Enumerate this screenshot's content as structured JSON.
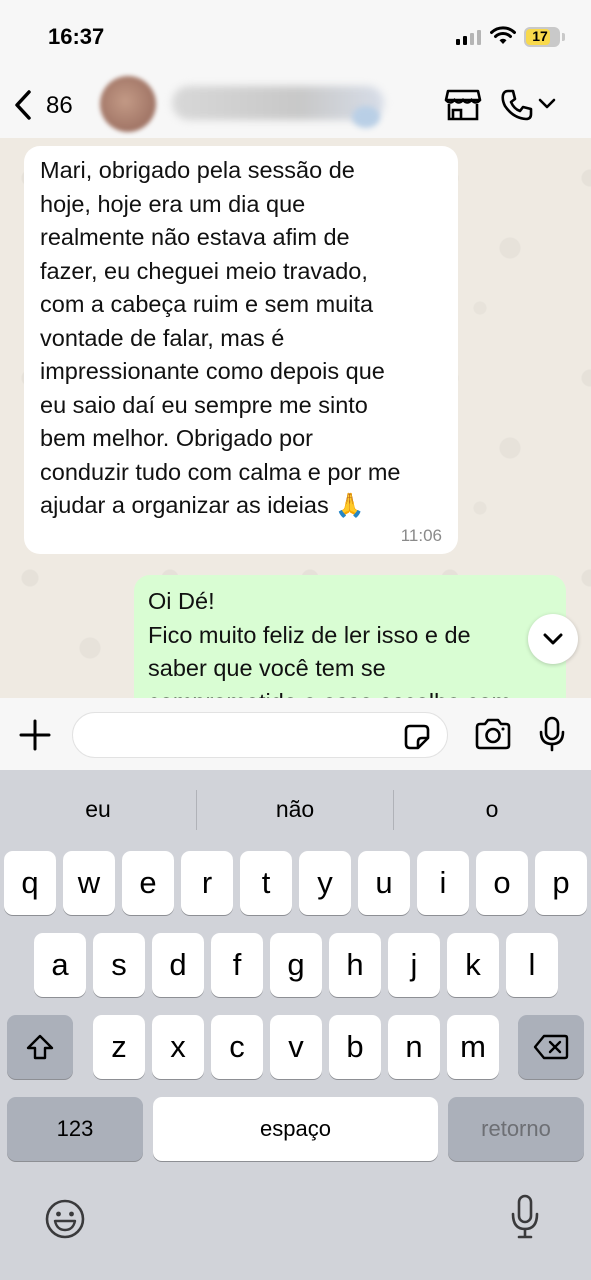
{
  "status_bar": {
    "time": "16:37",
    "battery": "17"
  },
  "header": {
    "unread_count": "86"
  },
  "messages": {
    "incoming": {
      "text": "Mari, obrigado pela sessão de\nhoje, hoje era um dia que\nrealmente não estava afim de\nfazer, eu cheguei meio travado,\ncom a cabeça ruim e sem muita\nvontade de falar, mas é\nimpressionante como depois que\neu saio daí eu sempre me sinto\nbem melhor. Obrigado por\nconduzir tudo com calma e por me\najudar a organizar as ideias 🙏",
      "time": "11:06"
    },
    "outgoing": {
      "text": "Oi Dé!\nFico muito feliz de ler isso e de\nsaber que você tem se\ncomprometido a essa escolha com"
    }
  },
  "keyboard": {
    "suggestions": [
      "eu",
      "não",
      "o"
    ],
    "row1": [
      "q",
      "w",
      "e",
      "r",
      "t",
      "y",
      "u",
      "i",
      "o",
      "p"
    ],
    "row2": [
      "a",
      "s",
      "d",
      "f",
      "g",
      "h",
      "j",
      "k",
      "l"
    ],
    "row3": [
      "z",
      "x",
      "c",
      "v",
      "b",
      "n",
      "m"
    ],
    "numbers_label": "123",
    "space_label": "espaço",
    "return_label": "retorno"
  },
  "colors": {
    "outgoing_bubble": "#d9fdd3",
    "incoming_bubble": "#ffffff",
    "chat_background": "#efeae2",
    "keyboard_background": "#d1d3d9"
  },
  "icons": [
    "back-chevron-icon",
    "store-icon",
    "phone-icon",
    "chevron-down-icon",
    "plus-icon",
    "sticker-icon",
    "camera-icon",
    "microphone-icon",
    "shift-icon",
    "backspace-icon",
    "emoji-icon",
    "dictation-icon"
  ]
}
